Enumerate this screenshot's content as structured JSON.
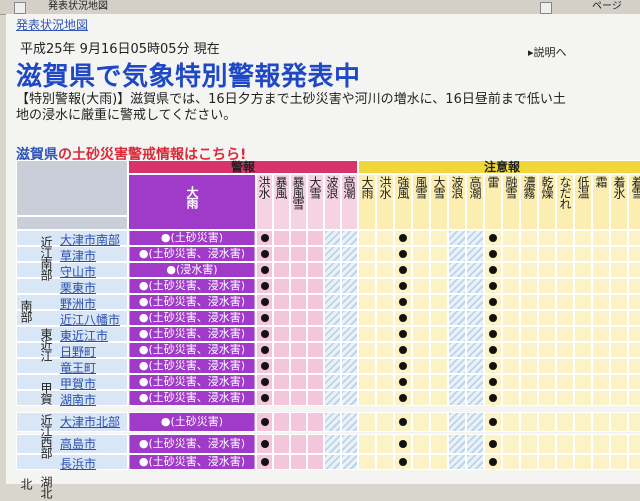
{
  "browser": {
    "items": [
      "発表状況地図",
      "ページ"
    ]
  },
  "breadcrumb": "発表状況地図",
  "timestamp": "平成25年  9月16日05時05分  現在",
  "explain_link": "説明へ",
  "title": "滋賀県で気象特別警報発表中",
  "description": "【特別警報(大雨)】滋賀県では、16日夕方まで土砂災害や河川の増水に、16日昼前まで低い土地の浸水に厳重に警戒してください。",
  "sediment_link": {
    "pref": "滋賀県",
    "rest": "の土砂災害警戒情報はこちら!"
  },
  "table": {
    "group_keihou": "警報",
    "group_chuuihou": "注意報",
    "col_ooame": "大雨",
    "warning_cols": [
      "洪水",
      "暴風",
      "暴風雪",
      "大雪",
      "波浪",
      "高潮"
    ],
    "advisory_cols": [
      "大雨",
      "洪水",
      "強風",
      "風雪",
      "大雪",
      "波浪",
      "高潮",
      "雷",
      "融雪",
      "濃霧",
      "乾燥",
      "なだれ",
      "低温",
      "霜",
      "着氷",
      "着雪"
    ],
    "region_major": [
      "南部",
      "北"
    ],
    "subregions": [
      "近江南部",
      "東近江",
      "甲賀",
      "近江西部",
      "湖北"
    ],
    "rows": [
      {
        "city": "大津市南部",
        "ooame": "●(土砂災害)"
      },
      {
        "city": "草津市",
        "ooame": "●(土砂災害、浸水害)"
      },
      {
        "city": "守山市",
        "ooame": "●(浸水害)"
      },
      {
        "city": "栗東市",
        "ooame": "●(土砂災害、浸水害)"
      },
      {
        "city": "野洲市",
        "ooame": "●(土砂災害、浸水害)"
      },
      {
        "city": "近江八幡市",
        "ooame": "●(土砂災害、浸水害)"
      },
      {
        "city": "東近江市",
        "ooame": "●(土砂災害、浸水害)"
      },
      {
        "city": "日野町",
        "ooame": "●(土砂災害、浸水害)"
      },
      {
        "city": "竜王町",
        "ooame": "●(土砂災害、浸水害)"
      },
      {
        "city": "甲賀市",
        "ooame": "●(土砂災害、浸水害)"
      },
      {
        "city": "湖南市",
        "ooame": "●(土砂災害、浸水害)"
      },
      {
        "city": "大津市北部",
        "ooame": "●(土砂災害)"
      },
      {
        "city": "高島市",
        "ooame": "●(土砂災害、浸水害)"
      },
      {
        "city": "長浜市",
        "ooame": "●(土砂災害、浸水害)"
      }
    ]
  },
  "colors": {
    "title": "#1f48c6",
    "warning_header": "#d8336b",
    "warning_cell": "#f3c6dc",
    "ooame_header": "#a03bc9",
    "advisory_header": "#f0d73a",
    "advisory_cell": "#fbf2c6",
    "region_cell": "#d9e6f5"
  }
}
